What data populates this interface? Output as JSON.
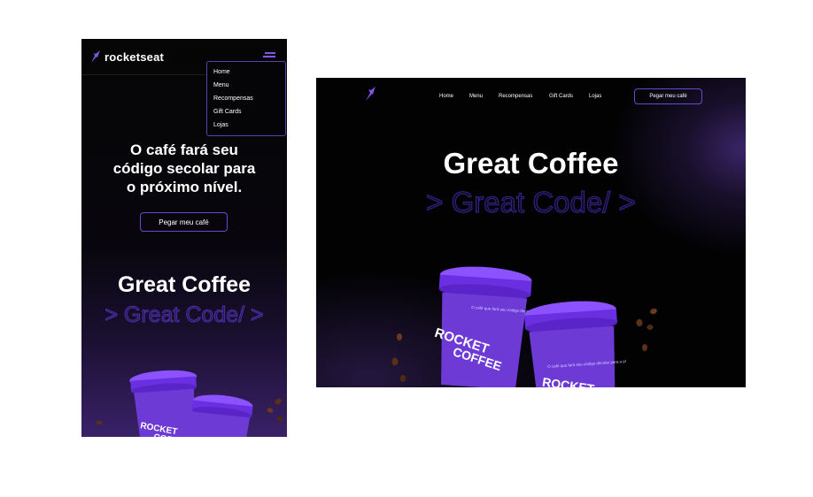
{
  "mobile": {
    "logo_text": "rocketseat",
    "menu": {
      "items": [
        "Home",
        "Menu",
        "Recompensas",
        "Gift Cards",
        "Lojas"
      ]
    },
    "headline": [
      "O café fará seu",
      "código secolar para",
      "o próximo nível."
    ],
    "cta_label": "Pegar meu café",
    "title": "Great Coffee",
    "outline": "> Great Code/ >"
  },
  "desktop": {
    "nav": [
      "Home",
      "Menu",
      "Recompensas",
      "Gift Cards",
      "Lojas"
    ],
    "cta_label": "Pegar meu café",
    "title": "Great Coffee",
    "outline": "> Great Code/ >"
  },
  "cup": {
    "line1": "ROCKET",
    "line2": "COFFEE",
    "tagline": "O café que fará seu código decolar para o próximo nível"
  },
  "colors": {
    "brand": "#8257e5",
    "lid": "#7a3ff0",
    "cup_body": "#6d3ad6",
    "background": "#000000"
  }
}
